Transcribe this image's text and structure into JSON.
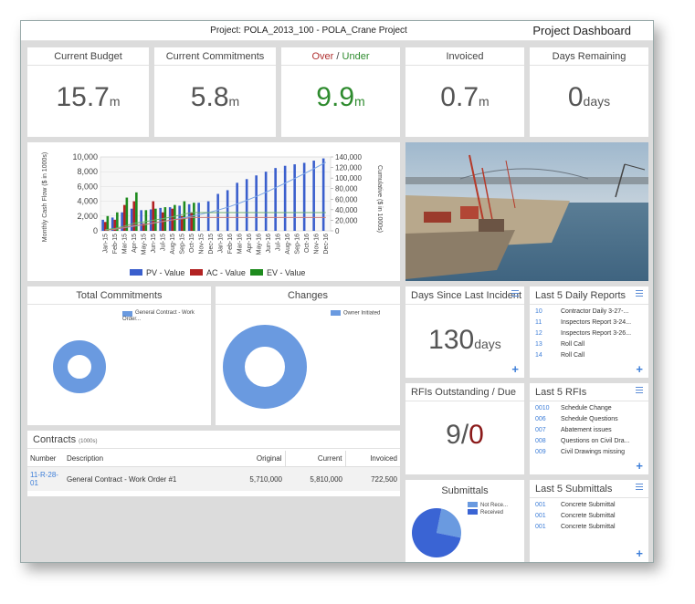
{
  "header": {
    "project": "Project: POLA_2013_100 - POLA_Crane Project",
    "title": "Project Dashboard"
  },
  "kpis": {
    "budget": {
      "title": "Current Budget",
      "value": "15.7",
      "unit": "m"
    },
    "commitments": {
      "title": "Current Commitments",
      "value": "5.8",
      "unit": "m"
    },
    "over_under": {
      "title_over": "Over",
      "title_sep": " / ",
      "title_under": "Under",
      "value": "9.9",
      "unit": "m",
      "color": "#2e8b2e"
    },
    "invoiced": {
      "title": "Invoiced",
      "value": "0.7",
      "unit": "m"
    },
    "days_remaining": {
      "title": "Days Remaining",
      "value": "0",
      "unit": "days"
    }
  },
  "cashflow": {
    "ylabel_left": "Monthly Cash Flow ($ in 1000s)",
    "ylabel_right": "Cumulative ($ in 1000s)",
    "left_ticks": [
      "10,000",
      "8,000",
      "6,000",
      "4,000",
      "2,000",
      "0"
    ],
    "right_ticks": [
      "140,000",
      "120,000",
      "100,000",
      "80,000",
      "60,000",
      "40,000",
      "20,000",
      "0"
    ],
    "legend": [
      {
        "name": "PV - Value",
        "color": "#3a5fcd"
      },
      {
        "name": "AC - Value",
        "color": "#b22222"
      },
      {
        "name": "EV - Value",
        "color": "#1e8b1e"
      }
    ]
  },
  "chart_data": {
    "type": "bar",
    "categories": [
      "Jan-15",
      "Feb-15",
      "Mar-15",
      "Apr-15",
      "May-15",
      "Jun-15",
      "Jul-15",
      "Aug-15",
      "Sep-15",
      "Oct-15",
      "Nov-15",
      "Dec-15",
      "Jan-16",
      "Feb-16",
      "Mar-16",
      "Apr-16",
      "May-16",
      "Jun-16",
      "Jul-16",
      "Aug-16",
      "Sep-16",
      "Oct-16",
      "Nov-16",
      "Dec-16"
    ],
    "series": [
      {
        "name": "PV - Value",
        "values": [
          1500,
          1800,
          2500,
          3000,
          2800,
          2900,
          3100,
          3200,
          3400,
          3600,
          3800,
          4000,
          5000,
          5500,
          6500,
          7000,
          7500,
          8000,
          8500,
          8800,
          9000,
          9200,
          9500,
          9800
        ]
      },
      {
        "name": "AC - Value",
        "values": [
          1200,
          1500,
          3500,
          4000,
          1000,
          4000,
          2500,
          3000,
          2000,
          2500,
          0,
          0,
          0,
          0,
          0,
          0,
          0,
          0,
          0,
          0,
          0,
          0,
          0,
          0
        ]
      },
      {
        "name": "EV - Value",
        "values": [
          2000,
          2500,
          4500,
          5200,
          2800,
          3000,
          3200,
          3500,
          4000,
          3800,
          0,
          0,
          0,
          0,
          0,
          0,
          0,
          0,
          0,
          0,
          0,
          0,
          0,
          0
        ]
      }
    ],
    "left_ylim": [
      0,
      10000
    ],
    "right_ylim": [
      0,
      140000
    ]
  },
  "total_commitments": {
    "title": "Total Commitments",
    "legend": "General Contract - Work Order...",
    "color": "#6a9ae0"
  },
  "changes": {
    "title": "Changes",
    "legend": "Owner Initiated",
    "color": "#6a9ae0"
  },
  "contracts": {
    "title": "Contracts",
    "subtitle": "(1000s)",
    "headers": [
      "Number",
      "Description",
      "Original",
      "Current",
      "Invoiced"
    ],
    "rows": [
      {
        "number": "11-R-28-01",
        "description": "General Contract - Work Order #1",
        "original": "5,710,000",
        "current": "5,810,000",
        "invoiced": "722,500"
      }
    ]
  },
  "incident": {
    "title": "Days Since Last Incident",
    "value": "130",
    "unit": "days"
  },
  "rfis_outstanding": {
    "title": "RFIs Outstanding / Due",
    "outstanding": "9",
    "sep": "/",
    "due": "0",
    "due_color": "#8b1a1a"
  },
  "submittals": {
    "title": "Submittals",
    "legend": [
      {
        "name": "Not Rece...",
        "color": "#6a9ae0"
      },
      {
        "name": "Received",
        "color": "#3a64d4"
      }
    ],
    "values": [
      {
        "label": "Not Rece...",
        "value": 25
      },
      {
        "label": "Received",
        "value": 75
      }
    ]
  },
  "daily_reports": {
    "title": "Last 5 Daily Reports",
    "items": [
      {
        "num": "10",
        "text": "Contractor Daily 3-27-..."
      },
      {
        "num": "11",
        "text": "Inspectors Report 3-24..."
      },
      {
        "num": "12",
        "text": "Inspectors Report 3-26..."
      },
      {
        "num": "13",
        "text": "Roll Call"
      },
      {
        "num": "14",
        "text": "Roll Call"
      }
    ]
  },
  "rfis": {
    "title": "Last 5 RFIs",
    "items": [
      {
        "num": "0010",
        "text": "Schedule Change"
      },
      {
        "num": "006",
        "text": "Schedule Questions"
      },
      {
        "num": "007",
        "text": "Abatement issues"
      },
      {
        "num": "008",
        "text": "Questions on Civil Dra..."
      },
      {
        "num": "009",
        "text": "Civil Drawings missing"
      }
    ]
  },
  "last_submittals": {
    "title": "Last 5 Submittals",
    "items": [
      {
        "num": "001",
        "text": "Concrete Submittal"
      },
      {
        "num": "001",
        "text": "Concrete Submittal"
      },
      {
        "num": "001",
        "text": "Concrete Submittal"
      }
    ]
  },
  "icons": {
    "menu": "menu-icon",
    "plus": "plus-icon"
  }
}
